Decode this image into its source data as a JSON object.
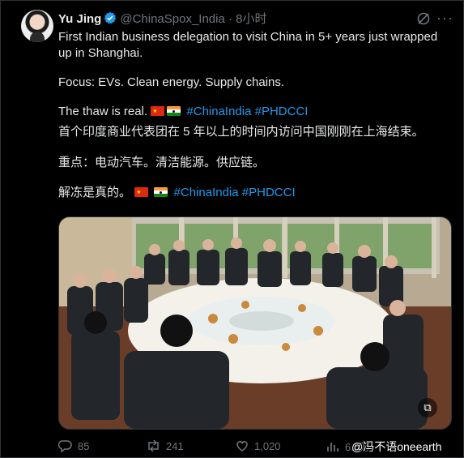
{
  "tweet": {
    "author_name": "Yu Jing",
    "handle": "@ChinaSpox_India",
    "time": "8小时",
    "line1": "First Indian business delegation to visit China in 5+ years just wrapped up in Shanghai.",
    "line2": "Focus: EVs. Clean energy. Supply chains.",
    "line3_text": "The thaw is real.",
    "hashtag1": "#ChinaIndia",
    "hashtag2": "#PHDCCI",
    "zh1": "首个印度商业代表团在 5 年以上的时间内访问中国刚刚在上海结束。",
    "zh2": "重点：电动汽车。清洁能源。供应链。",
    "zh3_text": "解冻是真的。",
    "verified_color": "#1d9bf0"
  },
  "actions": {
    "replies": "85",
    "reposts": "241",
    "likes": "1,020",
    "views": "6.5万"
  },
  "watermark": "@冯不语oneearth"
}
